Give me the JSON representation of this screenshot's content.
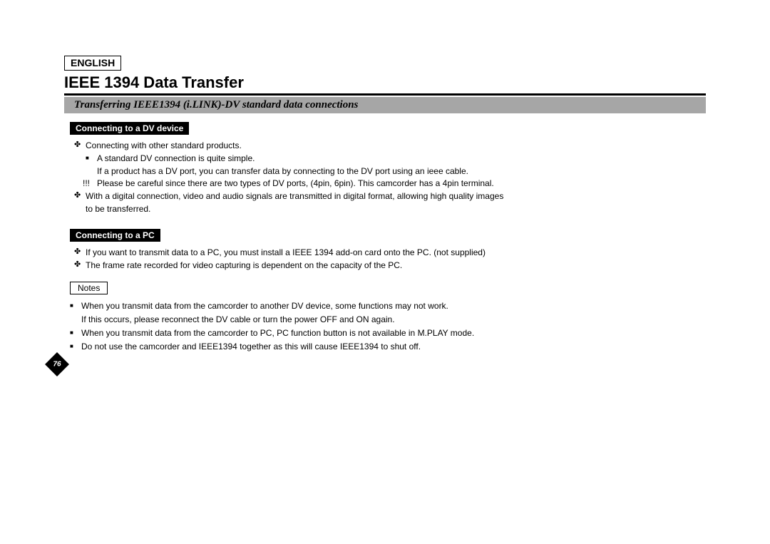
{
  "language_badge": "ENGLISH",
  "title": "IEEE 1394 Data Transfer",
  "subtitle": "Transferring IEEE1394 (i.LINK)-DV standard data connections",
  "section_dv": {
    "heading": "Connecting to a DV device",
    "l1_a": "Connecting with other standard products.",
    "l2_a": "A standard DV connection is quite simple.",
    "l2_a_cont": "If a product has a DV port, you can transfer data by connecting to the DV port using an ieee cable.",
    "l2_warn": "Please be careful since there are two types of DV ports, (4pin, 6pin). This camcorder has a 4pin terminal.",
    "l1_b": "With a digital connection, video and audio signals are transmitted in digital format, allowing high quality images",
    "l1_b_cont": "to be transferred."
  },
  "section_pc": {
    "heading": "Connecting to a PC",
    "l1_a": "If you want to transmit data to a PC, you must install a IEEE 1394 add-on card onto the PC. (not supplied)",
    "l1_b": "The frame rate recorded for video capturing is dependent on the capacity of the PC."
  },
  "notes": {
    "label": "Notes",
    "n1": "When you transmit data from the camcorder to another DV device, some functions may not work.",
    "n1_cont": "If this occurs, please reconnect the DV cable or turn the power OFF and ON again.",
    "n2": "When you transmit data from the camcorder to PC, PC function button is not available in M.PLAY mode.",
    "n3": "Do not use the camcorder and IEEE1394 together as this will cause IEEE1394 to shut off."
  },
  "page_number": "76"
}
